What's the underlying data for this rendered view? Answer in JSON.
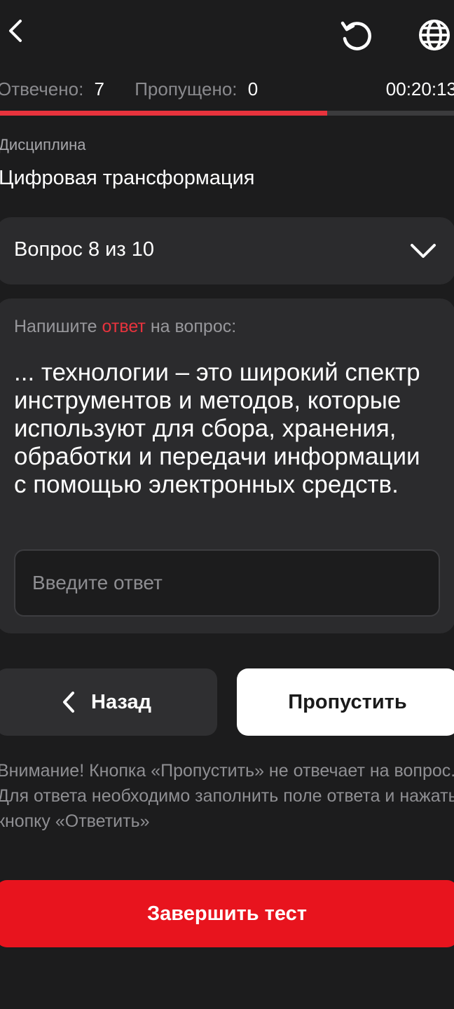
{
  "header": {
    "back_icon": "chevron-left-icon",
    "reset_icon": "refresh-icon",
    "language_icon": "globe-icon"
  },
  "stats": {
    "answered_label": "Отвечено:",
    "answered_value": "7",
    "skipped_label": "Пропущено:",
    "skipped_value": "0",
    "timer": "00:20:13"
  },
  "progress": {
    "fraction": 0.72,
    "fill_color": "#e8333d"
  },
  "discipline": {
    "label": "Дисциплина",
    "value": "Цифровая трансформация"
  },
  "question_selector": {
    "label": "Вопрос 8 из 10",
    "icon": "chevron-down-icon"
  },
  "question_card": {
    "prompt_prefix": "Напишите",
    "prompt_accent": "ответ",
    "prompt_suffix": "на вопрос:",
    "text": "... технологии – это широкий спектр инструментов и методов, которые используют для сбора, хранения, обработки и передачи информации с помощью электронных средств.",
    "input_placeholder": "Введите ответ"
  },
  "buttons": {
    "back_label": "Назад",
    "skip_label": "Пропустить",
    "finish_label": "Завершить тест"
  },
  "warning": "Внимание! Кнопка «Пропустить» не отвечает на вопрос. Для ответа необходимо заполнить поле ответа и нажать кнопку «Ответить»",
  "colors": {
    "accent": "#e8141e",
    "background": "#1c1c1d",
    "card": "#2b2b2d"
  }
}
